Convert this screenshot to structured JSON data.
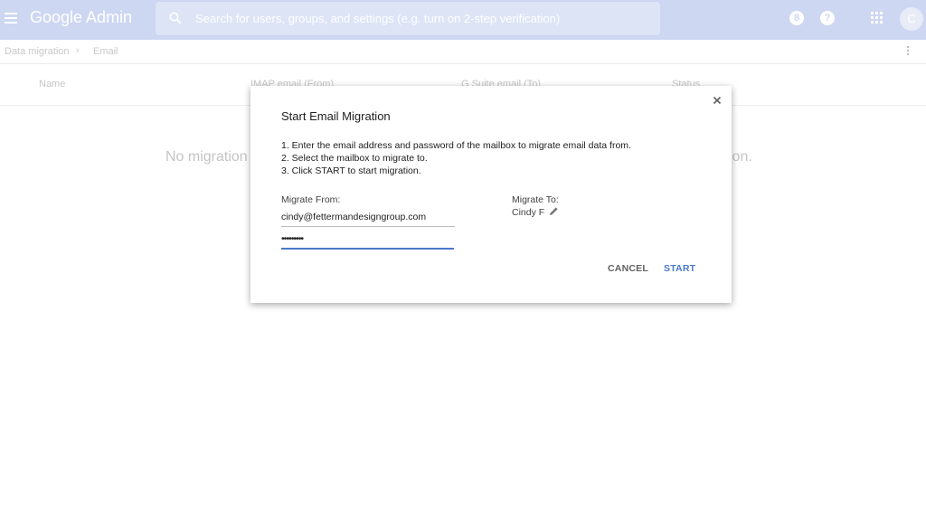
{
  "header": {
    "app_name": "Google Admin",
    "search_placeholder": "Search for users, groups, and settings (e.g. turn on 2-step verification)",
    "notification_badge": "8",
    "help_symbol": "?",
    "avatar_initial": "C",
    "icons": [
      "menu-icon",
      "search-icon",
      "notification-icon",
      "help-icon",
      "apps-icon"
    ]
  },
  "breadcrumb": {
    "items": [
      "Data migration",
      "Email"
    ],
    "separator": "›"
  },
  "table": {
    "columns": [
      "Name",
      "IMAP email (From)",
      "G Suite email (To)",
      "Status"
    ],
    "empty_text_left": "No migration",
    "empty_text_right": "ion."
  },
  "dialog": {
    "title": "Start Email Migration",
    "steps": [
      "1. Enter the email address and password of the mailbox to migrate email data from.",
      "2. Select the mailbox to migrate to.",
      "3. Click START to start migration."
    ],
    "migrate_from_label": "Migrate From:",
    "email_value": "cindy@fettermandesigngroup.com",
    "password_value": "•••••••••",
    "migrate_to_label": "Migrate To:",
    "migrate_to_name": "Cindy F",
    "cancel_label": "CANCEL",
    "start_label": "START"
  },
  "colors": {
    "appbar": "#cdd7f2",
    "accent": "#4a78c8"
  }
}
